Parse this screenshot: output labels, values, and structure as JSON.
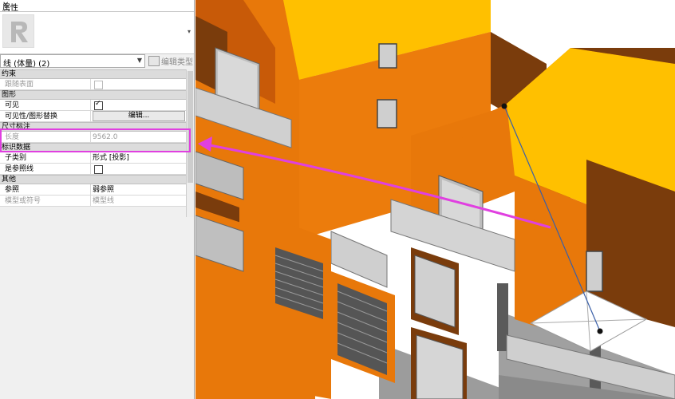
{
  "panel": {
    "title": "属性",
    "close_glyph": "✕",
    "type_selector": "线 (体量) (2)",
    "edit_type_label": "编辑类型",
    "sections": [
      {
        "id": "constraints",
        "title": "约束"
      },
      {
        "id": "graphics",
        "title": "图形"
      },
      {
        "id": "dimensions",
        "title": "尺寸标注"
      },
      {
        "id": "identity",
        "title": "标识数据"
      },
      {
        "id": "other",
        "title": "其他"
      }
    ],
    "rows": {
      "follow_surface": {
        "label": "跟随表面"
      },
      "visible": {
        "label": "可见"
      },
      "vis_override": {
        "label": "可见性/图形替换",
        "button": "编辑..."
      },
      "length": {
        "label": "长度",
        "value": "9562.0"
      },
      "subcategory": {
        "label": "子类别",
        "value": "形式 [投影]"
      },
      "is_ref_line": {
        "label": "是参照线"
      },
      "reference": {
        "label": "参照",
        "value": "弱参照"
      },
      "model_or_symbolic": {
        "label": "模型或符号",
        "value": "模型线"
      }
    }
  },
  "colors": {
    "highlight": "#e040e0",
    "wall_orange": "#e8780a",
    "roof_yellow": "#ffc000",
    "dark_brown": "#7a3c0c"
  },
  "icons": {
    "logo": "revit-logo-icon",
    "close": "close-icon",
    "dropdown": "chevron-down-icon",
    "edit_type": "edit-type-icon",
    "collapse": "chevron-up-icon"
  }
}
